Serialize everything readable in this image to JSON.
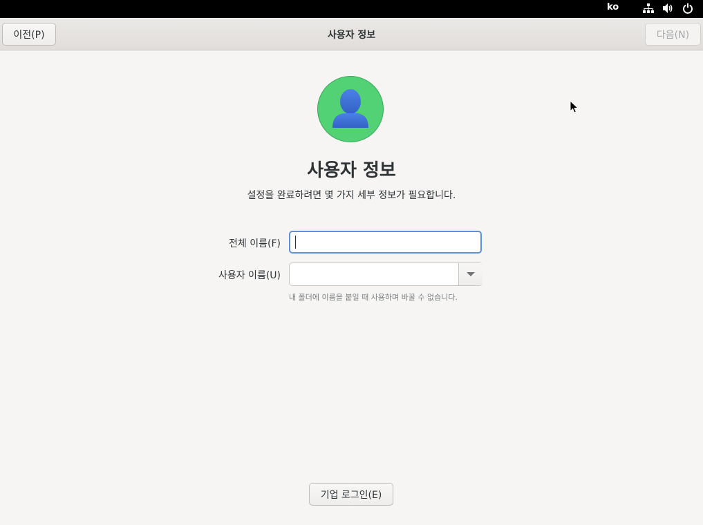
{
  "system_bar": {
    "language": "ko",
    "icons": [
      "network-icon",
      "volume-icon",
      "power-icon"
    ]
  },
  "header": {
    "title": "사용자 정보",
    "prev_label": "이전(P)",
    "next_label": "다음(N)"
  },
  "main": {
    "avatar_icon": "user-avatar-icon",
    "title": "사용자 정보",
    "subtitle": "설정을 완료하려면 몇 가지 세부 정보가 필요합니다.",
    "full_name": {
      "label": "전체 이름(F)",
      "value": ""
    },
    "username": {
      "label": "사용자 이름(U)",
      "value": "",
      "hint": "내 폴더에 이름을 붙일 때 사용하며 바꿀 수 없습니다."
    },
    "enterprise_label": "기업 로그인(E)"
  },
  "colors": {
    "avatar_bg": "#52d274",
    "avatar_figure": "#3f72d8",
    "focus": "#5c8fdc"
  }
}
